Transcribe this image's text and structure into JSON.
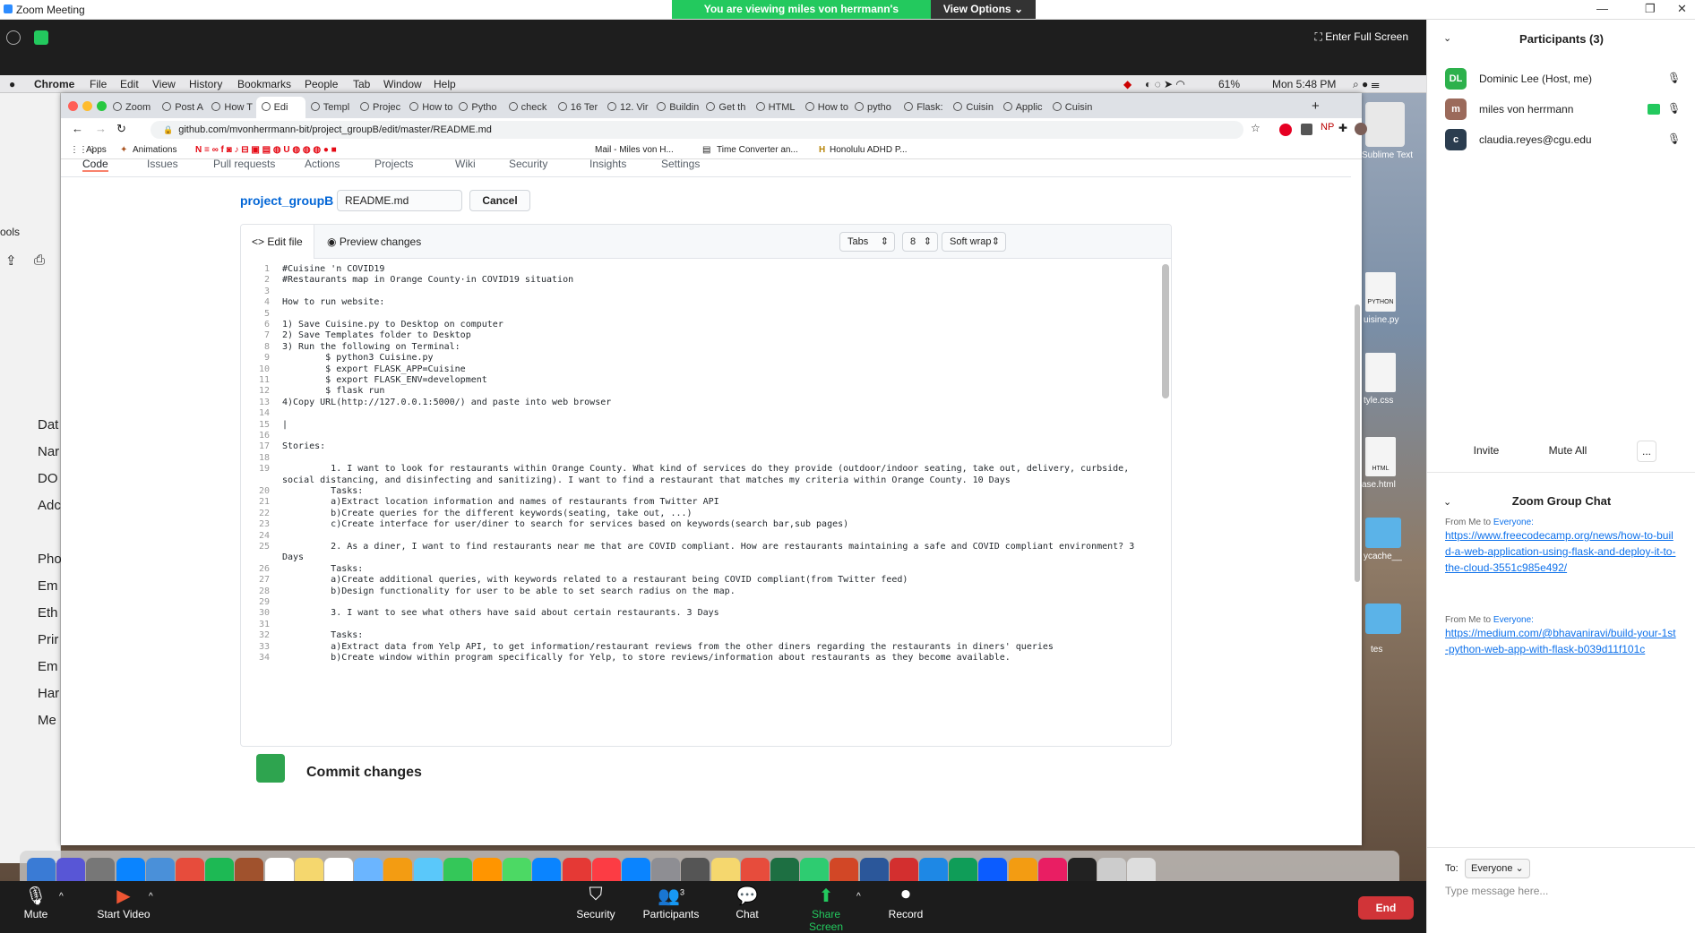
{
  "zoom": {
    "window_title": "Zoom Meeting",
    "banner_text": "You are viewing miles von herrmann's screen",
    "view_options": "View Options",
    "enter_full_screen": "Enter Full Screen"
  },
  "mac_menu": {
    "app": "Chrome",
    "items": [
      "File",
      "Edit",
      "View",
      "History",
      "Bookmarks",
      "People",
      "Tab",
      "Window",
      "Help"
    ],
    "battery": "61%",
    "clock": "Mon 5:48 PM"
  },
  "left_app": {
    "items": [
      "ools",
      "Dat",
      "Nar",
      "DO",
      "Adc",
      "Pho",
      "Em",
      "Eth",
      "Prir",
      "Em",
      "Har",
      "Me"
    ]
  },
  "chrome": {
    "tabs": [
      "Zoom",
      "Post A",
      "How T",
      "Edi",
      "Templ",
      "Projec",
      "How to",
      "Pytho",
      "check",
      "16 Ter",
      "12. Vir",
      "Buildin",
      "Get th",
      "HTML",
      "How to",
      "pytho",
      "Flask:",
      "Cuisin",
      "Applic",
      "Cuisin"
    ],
    "active_tab_index": 3,
    "url": "github.com/mvonherrmann-bit/project_groupB/edit/master/README.md",
    "bookmarks": [
      "Apps",
      "Animations",
      "Mail - Miles von H...",
      "Time Converter an...",
      "Honolulu ADHD P..."
    ]
  },
  "github": {
    "nav": [
      "Code",
      "Issues",
      "Pull requests",
      "Actions",
      "Projects",
      "Wiki",
      "Security",
      "Insights",
      "Settings"
    ],
    "repo": "project_groupB",
    "sep": "/",
    "filename": "README.md",
    "cancel": "Cancel",
    "edit_tab": "Edit file",
    "preview_tab": "Preview changes",
    "indent_mode": "Tabs",
    "indent_size": "8",
    "wrap_mode": "Soft wrap",
    "commit_title": "Commit changes",
    "lines": [
      {
        "n": "1",
        "t": "#Cuisine 'n COVID19"
      },
      {
        "n": "2",
        "t": "#Restaurants map in Orange County·in COVID19 situation"
      },
      {
        "n": "3",
        "t": ""
      },
      {
        "n": "4",
        "t": "How to run website:"
      },
      {
        "n": "5",
        "t": ""
      },
      {
        "n": "6",
        "t": "1) Save Cuisine.py to Desktop on computer"
      },
      {
        "n": "7",
        "t": "2) Save Templates folder to Desktop"
      },
      {
        "n": "8",
        "t": "3) Run the following on Terminal:"
      },
      {
        "n": "9",
        "t": "        $ python3 Cuisine.py"
      },
      {
        "n": "10",
        "t": "        $ export FLASK_APP=Cuisine"
      },
      {
        "n": "11",
        "t": "        $ export FLASK_ENV=development"
      },
      {
        "n": "12",
        "t": "        $ flask run"
      },
      {
        "n": "13",
        "t": "4)Copy URL(http://127.0.0.1:5000/) and paste into web browser"
      },
      {
        "n": "14",
        "t": ""
      },
      {
        "n": "15",
        "t": "|"
      },
      {
        "n": "16",
        "t": ""
      },
      {
        "n": "17",
        "t": "Stories:"
      },
      {
        "n": "18",
        "t": ""
      },
      {
        "n": "19",
        "t": "         1. I want to look for restaurants within Orange County. What kind of services do they provide (outdoor/indoor seating, take out, delivery, curbside,"
      },
      {
        "n": "",
        "t": "social distancing, and disinfecting and sanitizing). I want to find a restaurant that matches my criteria within Orange County. 10 Days"
      },
      {
        "n": "20",
        "t": "         Tasks:"
      },
      {
        "n": "21",
        "t": "         a)Extract location information and names of restaurants from Twitter API"
      },
      {
        "n": "22",
        "t": "         b)Create queries for the different keywords(seating, take out, ...)"
      },
      {
        "n": "23",
        "t": "         c)Create interface for user/diner to search for services based on keywords(search bar,sub pages)"
      },
      {
        "n": "24",
        "t": ""
      },
      {
        "n": "25",
        "t": "         2. As a diner, I want to find restaurants near me that are COVID compliant. How are restaurants maintaining a safe and COVID compliant environment? 3"
      },
      {
        "n": "",
        "t": "Days"
      },
      {
        "n": "26",
        "t": "         Tasks:"
      },
      {
        "n": "27",
        "t": "         a)Create additional queries, with keywords related to a restaurant being COVID compliant(from Twitter feed)"
      },
      {
        "n": "28",
        "t": "         b)Design functionality for user to be able to set search radius on the map."
      },
      {
        "n": "29",
        "t": ""
      },
      {
        "n": "30",
        "t": "         3. I want to see what others have said about certain restaurants. 3 Days"
      },
      {
        "n": "31",
        "t": ""
      },
      {
        "n": "32",
        "t": "         Tasks:"
      },
      {
        "n": "33",
        "t": "         a)Extract data from Yelp API, to get information/restaurant reviews from the other diners regarding the restaurants in diners' queries"
      },
      {
        "n": "34",
        "t": "         b)Create window within program specifically for Yelp, to store reviews/information about restaurants as they become available."
      }
    ]
  },
  "desktop_icons": [
    "Sublime Text",
    "PYTHON",
    "uisine.py",
    "tyle.css",
    "HTML",
    "ase.html",
    "ycache__",
    "tes"
  ],
  "zoom_toolbar": {
    "mute": "Mute",
    "video": "Start Video",
    "security": "Security",
    "participants": "Participants",
    "participants_count": "3",
    "chat": "Chat",
    "share": "Share Screen",
    "record": "Record",
    "end": "End"
  },
  "panel": {
    "participants_title": "Participants (3)",
    "participants": [
      {
        "initials": "DL",
        "name": "Dominic Lee (Host, me)",
        "color": "#2db14c"
      },
      {
        "initials": "m",
        "name": "miles von herrmann",
        "color": "#9b6a5b"
      },
      {
        "initials": "c",
        "name": "claudia.reyes@cgu.edu",
        "color": "#2b3d4f"
      }
    ],
    "invite": "Invite",
    "mute_all": "Mute All",
    "more": "...",
    "chat_title": "Zoom Group Chat",
    "messages": [
      {
        "from": "From Me to",
        "to": "Everyone:",
        "text": "https://www.freecodecamp.org/news/how-to-build-a-web-application-using-flask-and-deploy-it-to-the-cloud-3551c985e492/"
      },
      {
        "from": "From Me to",
        "to": "Everyone:",
        "text": "https://medium.com/@bhavaniravi/build-your-1st-python-web-app-with-flask-b039d11f101c"
      }
    ],
    "to_label": "To:",
    "to_value": "Everyone",
    "placeholder": "Type message here..."
  }
}
